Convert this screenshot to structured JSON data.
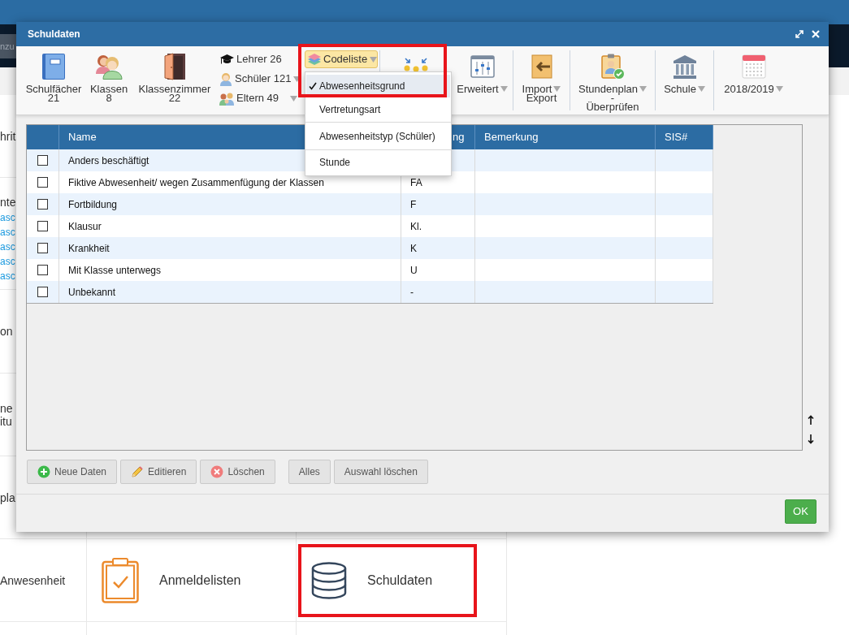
{
  "top_bar": {
    "search": {
      "placeholder": "nzu"
    }
  },
  "side_menu": [
    {
      "lines": [
        "hrit"
      ]
    },
    {
      "lines": [
        "nte"
      ],
      "links": [
        "asc",
        "asc",
        "asc",
        "asc",
        "asc"
      ]
    },
    {
      "lines": [
        "on"
      ]
    },
    {
      "lines": [
        "ne",
        "itu"
      ]
    },
    {
      "lines": [
        "pla"
      ]
    },
    {
      "lines": [
        "Anwesenheit"
      ]
    }
  ],
  "tiles": [
    {
      "label": "Anmeldelisten",
      "highlighted": false
    },
    {
      "label": "Schuldaten",
      "highlighted": true
    }
  ],
  "dialog": {
    "title": "Schuldaten",
    "toolbar": {
      "counters": [
        {
          "label": "Schulfächer",
          "count": "21"
        },
        {
          "label": "Klassen",
          "count": "8"
        },
        {
          "label": "Klassenzimmer",
          "count": "22"
        }
      ],
      "people": [
        {
          "label": "Lehrer 26",
          "dropdown": false
        },
        {
          "label": "Schüler 121",
          "dropdown": true
        },
        {
          "label": "Eltern 49",
          "dropdown": true
        }
      ],
      "codeliste": {
        "label": "Codeliste",
        "open": true,
        "highlighted": true,
        "menu": [
          {
            "label": "Abwesenheitsgrund",
            "selected": true
          },
          {
            "label": "Vertretungsart",
            "selected": false
          },
          {
            "label": "Abwesenheitstyp (Schüler)",
            "selected": false
          },
          {
            "label": "Stunde",
            "selected": false
          }
        ]
      },
      "tool_groups": [
        {
          "tools": [
            {
              "kind": "icon"
            },
            {
              "kind": "labeled",
              "lines": [
                "Erweitert"
              ],
              "dropdown": true
            }
          ]
        },
        {
          "tools": [
            {
              "kind": "labeled",
              "lines": [
                "Import",
                "Export"
              ],
              "dropdown": true
            }
          ]
        },
        {
          "tools": [
            {
              "kind": "labeled",
              "lines": [
                "Stundenplan",
                "-",
                "Überprüfen"
              ],
              "dropdown": true
            }
          ]
        },
        {
          "tools": [
            {
              "kind": "labeled",
              "lines": [
                "Schule"
              ],
              "dropdown": true
            }
          ]
        },
        {
          "tools": [
            {
              "kind": "labeled",
              "lines": [
                "2018/2019"
              ],
              "dropdown": true
            }
          ]
        }
      ]
    },
    "table": {
      "columns": [
        "Name",
        "ng",
        "Bemerkung",
        "SIS#"
      ],
      "rows": [
        {
          "checked": false,
          "name": "Anders beschäftigt"
        },
        {
          "checked": false,
          "name": "Fiktive Abwesenheit/ wegen Zusammenfügung der Klassen",
          "column_3": "FA"
        },
        {
          "checked": false,
          "name": "Fortbildung",
          "column_3": "F"
        },
        {
          "checked": false,
          "name": "Klausur",
          "column_3": "Kl."
        },
        {
          "checked": false,
          "name": "Krankheit",
          "column_3": "K"
        },
        {
          "checked": false,
          "name": "Mit Klasse unterwegs",
          "column_3": "U"
        },
        {
          "checked": false,
          "name": "Unbekannt",
          "column_3": "-"
        }
      ]
    },
    "actions": [
      {
        "buttons": [
          "Neue Daten",
          "Editieren",
          "Löschen"
        ]
      },
      {
        "buttons": [
          "Alles",
          "Auswahl löschen"
        ]
      }
    ],
    "ok_button": "OK"
  }
}
